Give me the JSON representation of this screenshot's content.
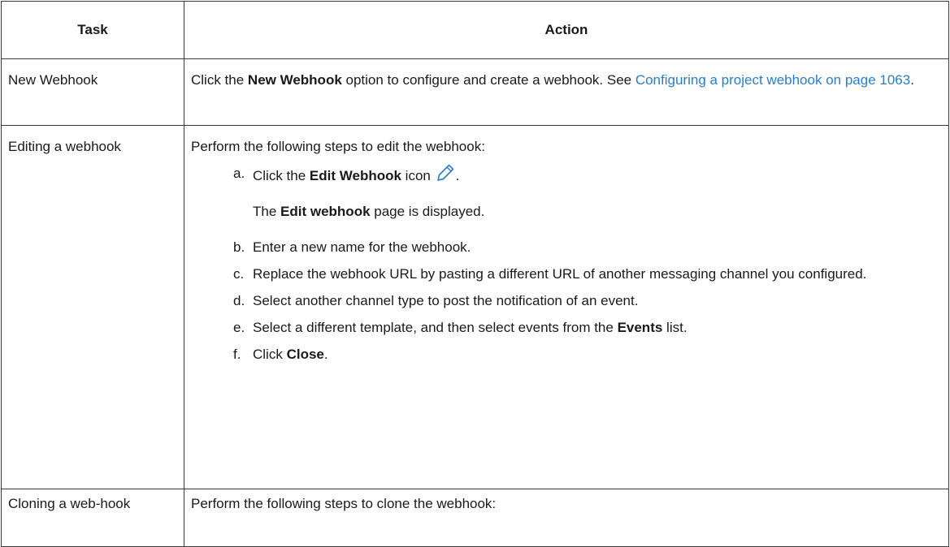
{
  "table": {
    "headers": {
      "task": "Task",
      "action": "Action"
    },
    "rows": {
      "new_webhook": {
        "task": "New Webhook",
        "action_prefix": "Click the ",
        "action_bold": "New Webhook",
        "action_mid": " option to configure and create a webhook. See ",
        "link_text": "Configuring a project webhook on page 1063",
        "action_suffix": "."
      },
      "editing": {
        "task": "Editing a webhook",
        "intro": "Perform the following steps to edit the webhook:",
        "steps": {
          "a": {
            "marker": "a.",
            "pre": "Click the ",
            "bold": "Edit Webhook",
            "post": " icon",
            "icon": "pencil-icon",
            "end": ".",
            "note_pre": "The ",
            "note_bold": "Edit webhook",
            "note_post": " page is displayed."
          },
          "b": {
            "marker": "b.",
            "text": "Enter a new name for the webhook."
          },
          "c": {
            "marker": "c.",
            "text": "Replace the webhook URL by pasting a different URL of another messaging channel you configured."
          },
          "d": {
            "marker": "d.",
            "text": "Select another channel type to post the notification of an event."
          },
          "e": {
            "marker": "e.",
            "pre": "Select a different template, and then select events from the ",
            "bold": "Events",
            "post": " list."
          },
          "f": {
            "marker": "f.",
            "pre": "Click ",
            "bold": "Close",
            "post": "."
          }
        }
      },
      "cloning": {
        "task": "Cloning a web-hook",
        "intro": "Perform the following steps to clone the webhook:"
      }
    }
  },
  "colors": {
    "link": "#2a7ec7",
    "icon_stroke": "#2a7ec7",
    "border": "#3a3a3a"
  }
}
